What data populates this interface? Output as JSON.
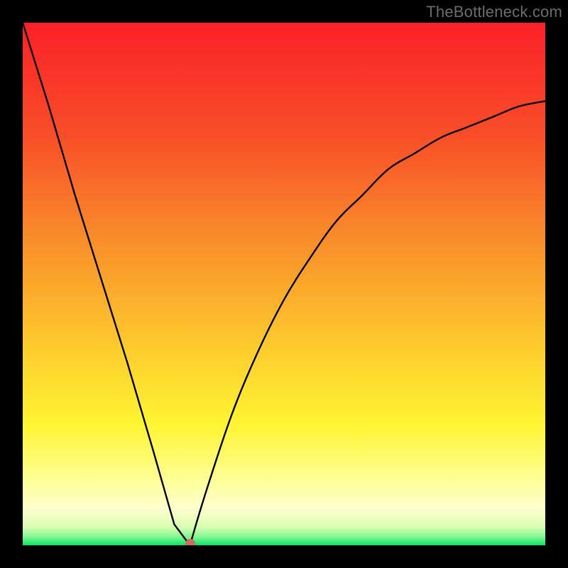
{
  "attribution": "TheBottleneck.com",
  "colors": {
    "frame": "#000000",
    "top": "#fb2028",
    "mid_orange": "#f98f2a",
    "mid_yellow": "#fff531",
    "pale": "#feffcd",
    "bottom": "#00e663",
    "curve": "#000000",
    "dot": "#d66a5b"
  },
  "chart_data": {
    "type": "line",
    "title": "",
    "xlabel": "",
    "ylabel": "",
    "xlim": [
      0,
      100
    ],
    "ylim": [
      0,
      100
    ],
    "grid": false,
    "legend": false,
    "annotations": [
      "TheBottleneck.com"
    ],
    "series": [
      {
        "name": "bottleneck-curve",
        "x": [
          0,
          5,
          10,
          15,
          20,
          25,
          27,
          29,
          30,
          32,
          35,
          40,
          45,
          50,
          55,
          60,
          65,
          70,
          75,
          80,
          85,
          90,
          95,
          100
        ],
        "values": [
          100,
          84,
          67,
          51,
          35,
          18,
          11,
          4,
          0,
          0,
          10,
          25,
          37,
          47,
          55,
          62,
          67,
          72,
          75,
          78,
          80,
          82,
          84,
          85
        ]
      }
    ],
    "marker": {
      "x": 32,
      "y": 0
    },
    "plateau": {
      "x_start": 29,
      "x_end": 32,
      "y": 0
    }
  }
}
